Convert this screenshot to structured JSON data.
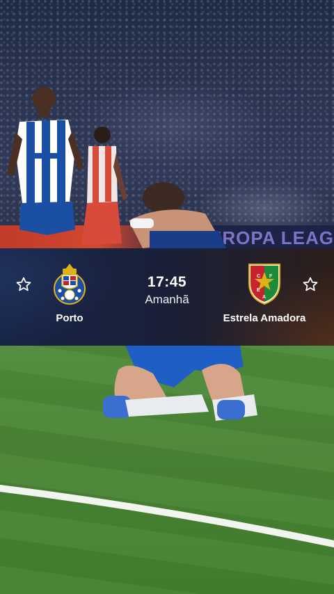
{
  "top_photo": {
    "ad_board_text": "EUROPA LEAG"
  },
  "match": {
    "home_team": {
      "name": "Porto",
      "crest_icon": "fc-porto-crest"
    },
    "away_team": {
      "name": "Estrela Amadora",
      "crest_icon": "estrela-amadora-crest",
      "crest_letters": [
        "C",
        "F",
        "E",
        "A"
      ]
    },
    "kickoff_time": "17:45",
    "kickoff_day": "Amanhã",
    "favorite_icon": "star-outline-icon"
  },
  "colors": {
    "porto_blue": "#1a4fa3",
    "estrela_red": "#c8232c",
    "estrela_green": "#1d8a3a",
    "card_left": "#162446",
    "card_right": "#2c1e1a"
  }
}
